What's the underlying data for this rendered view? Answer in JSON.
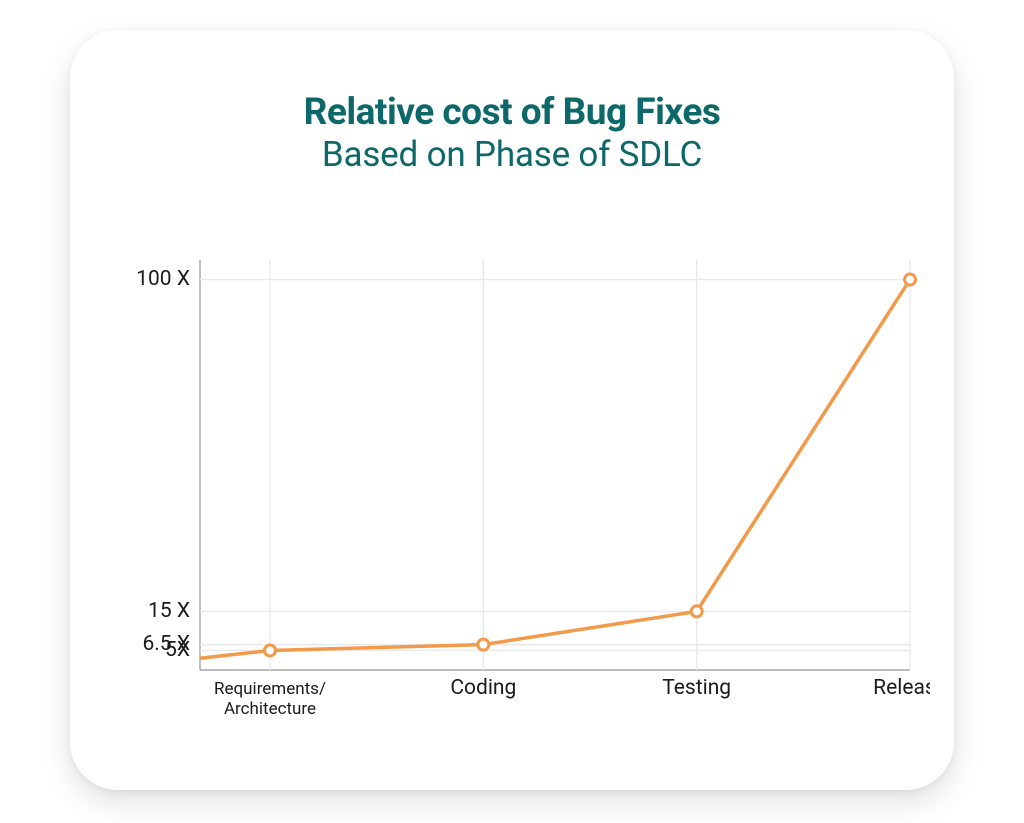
{
  "title": "Relative cost of Bug Fixes",
  "subtitle": "Based on Phase of SDLC",
  "chart_data": {
    "type": "line",
    "categories": [
      "Requirements/ Architecture",
      "Coding",
      "Testing",
      "Release"
    ],
    "values": [
      5,
      6.5,
      15,
      100
    ],
    "y_ticks": [
      5,
      6.5,
      15,
      100
    ],
    "y_tick_labels": [
      "5X",
      "6.5 X",
      "15 X",
      "100 X"
    ],
    "ylim": [
      0,
      105
    ],
    "line_color": "#f2994a",
    "title": "Relative cost of Bug Fixes",
    "subtitle": "Based on Phase of SDLC",
    "xlabel": "",
    "ylabel": ""
  }
}
